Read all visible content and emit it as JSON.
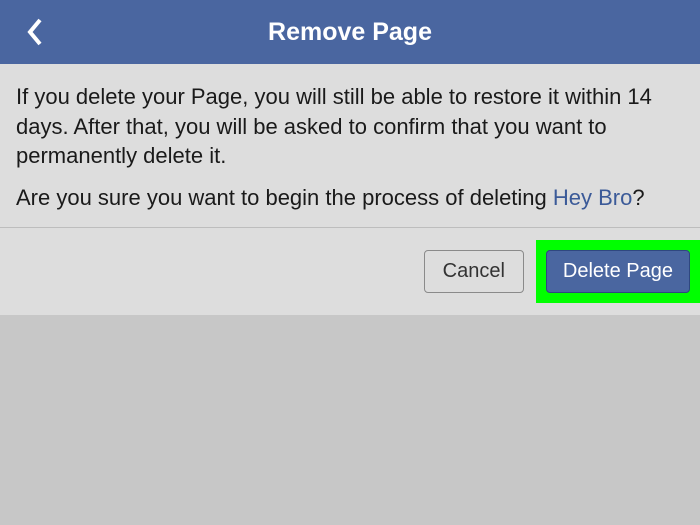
{
  "header": {
    "title": "Remove Page"
  },
  "content": {
    "notice": "If you delete your Page, you will still be able to restore it within 14 days. After that, you will be asked to confirm that you want to permanently delete it.",
    "confirm_prefix": "Are you sure you want to begin the process of deleting ",
    "page_name": "Hey Bro",
    "confirm_suffix": "?"
  },
  "buttons": {
    "cancel": "Cancel",
    "delete": "Delete Page"
  }
}
